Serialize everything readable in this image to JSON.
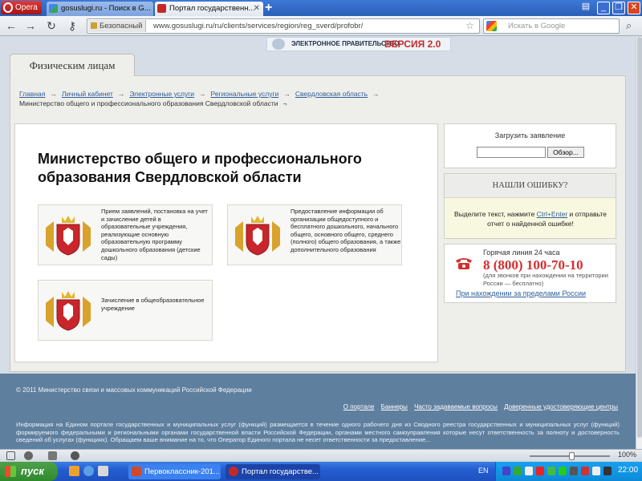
{
  "browser": {
    "menu_label": "Opera",
    "tabs": [
      {
        "label": "gosuslugi.ru - Поиск в G...",
        "active": false
      },
      {
        "label": "Портал государственн...",
        "active": true
      }
    ],
    "new_tab": "+",
    "secure_label": "Безопасный",
    "url": "www.gosuslugi.ru/ru/clients/services/region/reg_sverd/profobr/",
    "search_placeholder": "Искать в Google",
    "zoom": "100%"
  },
  "page": {
    "banner": {
      "gov_text": "ЭЛЕКТРОННОЕ ПРАВИТЕЛЬСТВО",
      "version": "ВЕРСИЯ 2.0"
    },
    "main_tab": "Физическим лицам",
    "breadcrumb": [
      "Главная",
      "Личный кабинет",
      "Электронные услуги",
      "Региональные услуги",
      "Свердловская область"
    ],
    "breadcrumb_current": "Министерство общего и профессионального образования Свердловской области",
    "title": "Министерство общего и профессионального образования Свердловской области",
    "services": [
      {
        "text": "Прием заявлений, постановка на учет и зачисление детей в образовательные учреждения, реализующие основную образовательную программу дошкольного образования (детские сады)"
      },
      {
        "text": "Предоставление информации об организации общедоступного и бесплатного дошкольного, начального общего, основного общего, среднего (полного) общего образования, а также дополнительного образования"
      },
      {
        "text": "Зачисление в общеобразовательное учреждение"
      }
    ],
    "upload": {
      "label": "Загрузить заявление",
      "browse": "Обзор..."
    },
    "error": {
      "header": "НАШЛИ ОШИБКУ?",
      "text_before": "Выделите текст, нажмите ",
      "shortcut": "Ctrl+Enter",
      "text_after": " и отправьте отчет о найденной ошибке!"
    },
    "hotline": {
      "label": "Горячая линия 24 часа",
      "number": "8 (800) 100-70-10",
      "note": "(для звонков при нахождении на территории России — бесплатно)",
      "abroad": "При нахождении за пределами России"
    },
    "footer": {
      "copyright": "© 2011 Министерство связи и массовых коммуникаций Российской Федерации",
      "links": [
        "О портале",
        "Баннеры",
        "Часто задаваемые вопросы",
        "Доверенные удостоверяющие центры"
      ],
      "info": "Информация на Едином портале государственных и муниципальных услуг (функций) размещается в течение одного рабочего дня из Сводного реестра государственных и муниципальных услуг (функций) формируемого федеральными и региональными органами государственной власти Российской Федерации, органами местного самоуправления которые несут ответственность за полноту и достоверность сведений об услугах (функциях). Обращаем ваше внимание на то, что Оператор Единого портала не несет ответственности за предоставление..."
    }
  },
  "taskbar": {
    "start": "пуск",
    "buttons": [
      {
        "label": "Первоклассник-201...",
        "active": false
      },
      {
        "label": "Портал государстве...",
        "active": true
      }
    ],
    "lang": "EN",
    "time": "22:00"
  },
  "colors": {
    "brand_red": "#d32f2f",
    "link": "#2f5f9b",
    "footer_bg": "#5f7f9f"
  }
}
